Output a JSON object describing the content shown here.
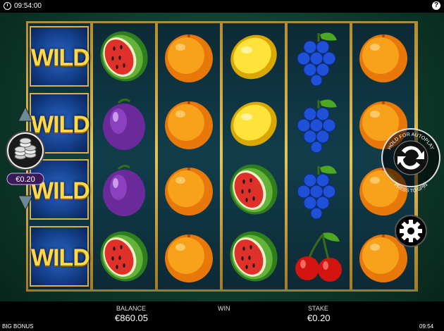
{
  "status_bar": {
    "time": "09:54:00",
    "help_label": "?"
  },
  "reels": [
    [
      "wild",
      "wild",
      "wild",
      "wild"
    ],
    [
      "watermelon",
      "plum",
      "plum",
      "watermelon"
    ],
    [
      "orange",
      "orange",
      "orange",
      "orange"
    ],
    [
      "lemon",
      "lemon",
      "watermelon",
      "watermelon"
    ],
    [
      "grapes",
      "grapes",
      "grapes",
      "cherries"
    ],
    [
      "orange",
      "orange",
      "orange",
      "orange"
    ]
  ],
  "wild_label": "WILD",
  "stake_widget": {
    "value": "€0.20"
  },
  "autoplay": {
    "top_text": "HOLD FOR AUTOPLAY",
    "bottom_text": "PRESS TO SPIN"
  },
  "footer": {
    "game_name": "BIG BONUS",
    "balance_label": "BALANCE",
    "balance_value": "€860.05",
    "win_label": "WIN",
    "win_value": "",
    "stake_label": "STAKE",
    "stake_value": "€0.20",
    "clock": "09:54"
  },
  "colors": {
    "felt": "#0e3a2c",
    "gold": "#d9b14a",
    "wild_blue": "#143f8a"
  }
}
